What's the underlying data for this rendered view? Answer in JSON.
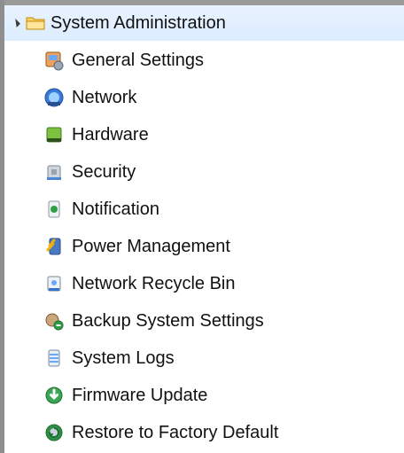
{
  "tree": {
    "root": {
      "label": "System Administration",
      "icon": "folder-icon",
      "expanded": true
    },
    "items": [
      {
        "label": "General Settings",
        "icon": "settings-icon"
      },
      {
        "label": "Network",
        "icon": "network-icon"
      },
      {
        "label": "Hardware",
        "icon": "hardware-icon"
      },
      {
        "label": "Security",
        "icon": "security-icon"
      },
      {
        "label": "Notification",
        "icon": "notification-icon"
      },
      {
        "label": "Power Management",
        "icon": "power-icon"
      },
      {
        "label": "Network Recycle Bin",
        "icon": "recycle-bin-icon"
      },
      {
        "label": "Backup System Settings",
        "icon": "backup-icon"
      },
      {
        "label": "System Logs",
        "icon": "logs-icon"
      },
      {
        "label": "Firmware Update",
        "icon": "firmware-icon"
      },
      {
        "label": "Restore to Factory Default",
        "icon": "restore-icon"
      }
    ]
  },
  "colors": {
    "selected_bg": "#dcecff",
    "border": "#8e8e8e",
    "text": "#111111"
  }
}
